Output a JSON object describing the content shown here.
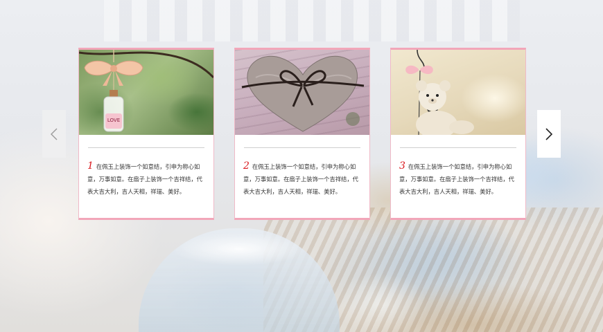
{
  "carousel": {
    "prev_icon": "chevron-left-icon",
    "next_icon": "chevron-right-icon",
    "items": [
      {
        "number": "1",
        "text": "在佩玉上装饰一个如意结，引申为称心如意，万事如意。在扇子上装饰一个吉祥结，代表大吉大利，吉人天相，祥瑞、美好。",
        "photo_label": "LOVE"
      },
      {
        "number": "2",
        "text": "在佩玉上装饰一个如意结，引申为称心如意，万事如意。在扇子上装饰一个吉祥结，代表大吉大利，吉人天相，祥瑞、美好。"
      },
      {
        "number": "3",
        "text": "在佩玉上装饰一个如意结，引申为称心如意，万事如意。在扇子上装饰一个吉祥结，代表大吉大利，吉人天相，祥瑞、美好。"
      }
    ]
  },
  "colors": {
    "accent_pink": "#f2a6b9",
    "number_red": "#d9171c"
  }
}
